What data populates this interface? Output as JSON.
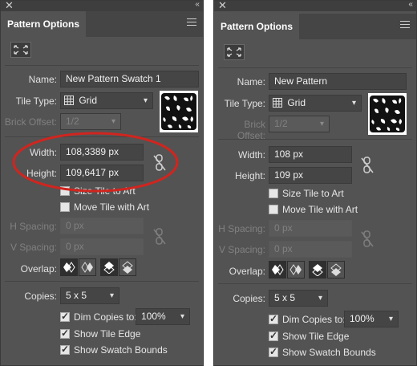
{
  "panels": [
    {
      "id": "left",
      "close_glyph": "✕",
      "collapse_glyph": "‹‹",
      "title": "Pattern Options",
      "name_label": "Name:",
      "name_value": "New Pattern Swatch 1",
      "tile_type_label": "Tile Type:",
      "tile_type_value": "Grid",
      "brick_offset_label": "Brick Offset:",
      "brick_offset_value": "1/2",
      "width_label": "Width:",
      "width_value": "108,3389 px",
      "height_label": "Height:",
      "height_value": "109,6417 px",
      "size_tile_label": "Size Tile to Art",
      "move_tile_label": "Move Tile with Art",
      "h_spacing_label": "H Spacing:",
      "h_spacing_value": "0 px",
      "v_spacing_label": "V Spacing:",
      "v_spacing_value": "0 px",
      "overlap_label": "Overlap:",
      "copies_label": "Copies:",
      "copies_value": "5 x 5",
      "dim_copies_label": "Dim Copies to:",
      "dim_copies_value": "100%",
      "show_tile_edge_label": "Show Tile Edge",
      "show_swatch_bounds_label": "Show Swatch Bounds"
    },
    {
      "id": "right",
      "close_glyph": "✕",
      "collapse_glyph": "‹‹",
      "title": "Pattern Options",
      "name_label": "Name:",
      "name_value": "New Pattern",
      "tile_type_label": "Tile Type:",
      "tile_type_value": "Grid",
      "brick_offset_label": "Brick Offset:",
      "brick_offset_value": "1/2",
      "width_label": "Width:",
      "width_value": "108 px",
      "height_label": "Height:",
      "height_value": "109 px",
      "size_tile_label": "Size Tile to Art",
      "move_tile_label": "Move Tile with Art",
      "h_spacing_label": "H Spacing:",
      "h_spacing_value": "0 px",
      "v_spacing_label": "V Spacing:",
      "v_spacing_value": "0 px",
      "overlap_label": "Overlap:",
      "copies_label": "Copies:",
      "copies_value": "5 x 5",
      "dim_copies_label": "Dim Copies to:",
      "dim_copies_value": "100%",
      "show_tile_edge_label": "Show Tile Edge",
      "show_swatch_bounds_label": "Show Swatch Bounds"
    }
  ],
  "annotation": {
    "color": "#d0251f"
  },
  "icons": [
    "close-icon",
    "collapse-icon",
    "panel-menu-icon",
    "fit-tile-icon",
    "grid-icon",
    "chevron-down-icon",
    "link-icon",
    "overlap-left-icon",
    "overlap-right-icon",
    "overlap-top-icon",
    "overlap-bottom-icon",
    "checkbox-icon"
  ]
}
